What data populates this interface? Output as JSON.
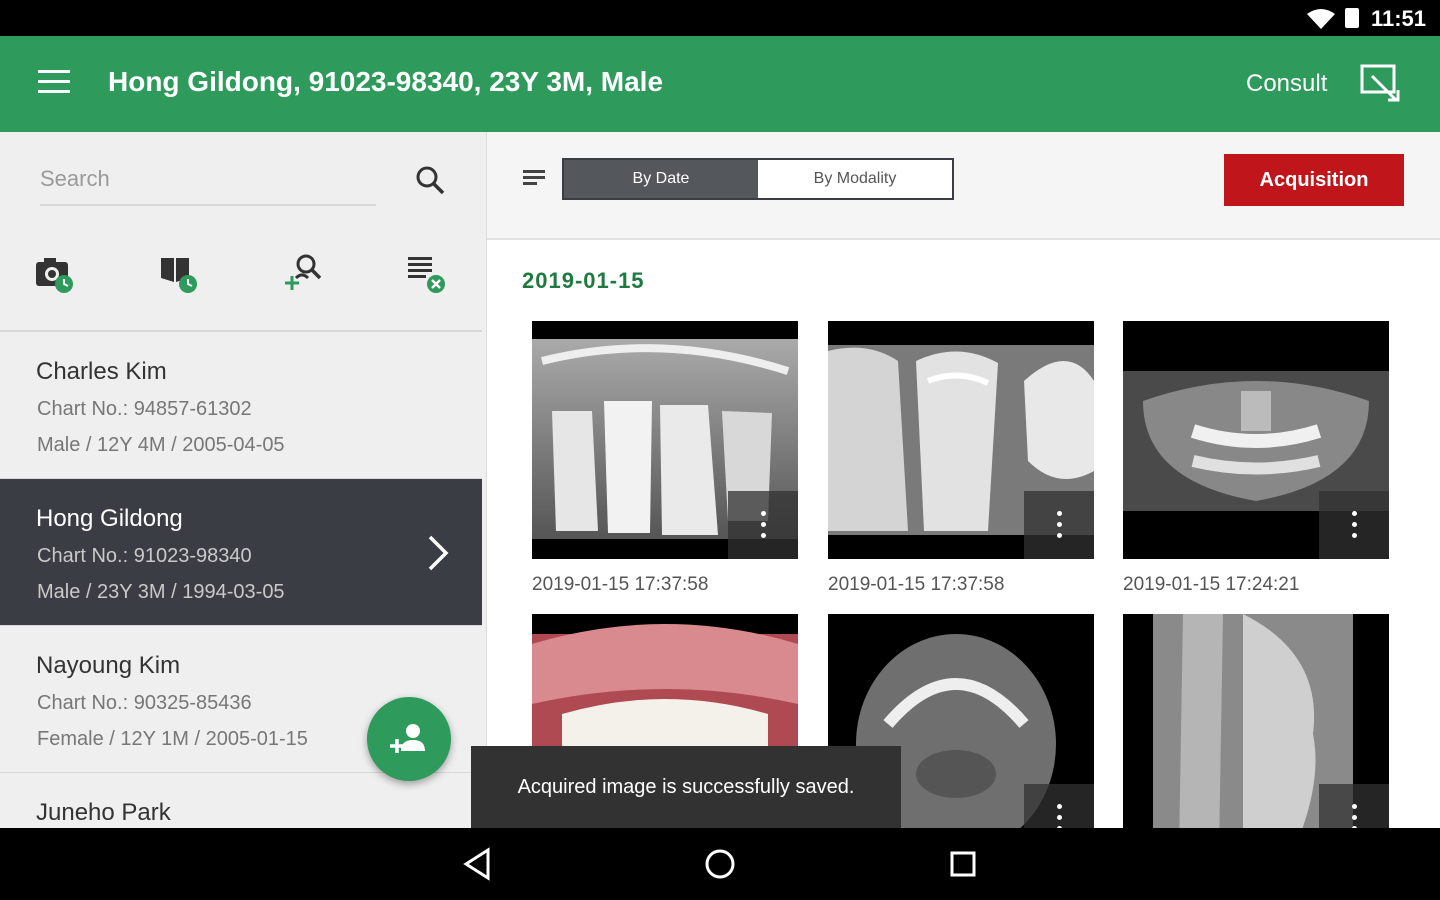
{
  "status": {
    "time": "11:51"
  },
  "header": {
    "title": "Hong Gildong, 91023-98340, 23Y 3M, Male",
    "consult_label": "Consult"
  },
  "search": {
    "placeholder": "Search"
  },
  "patients": [
    {
      "name": "Charles Kim",
      "chart": "Chart No.: 94857-61302",
      "info": "Male / 12Y 4M / 2005-04-05"
    },
    {
      "name": "Hong Gildong",
      "chart": "Chart No.: 91023-98340",
      "info": "Male / 23Y 3M / 1994-03-05"
    },
    {
      "name": "Nayoung Kim",
      "chart": "Chart No.: 90325-85436",
      "info": "Female / 12Y 1M / 2005-01-15"
    },
    {
      "name": "Juneho Park",
      "chart": "",
      "info": ""
    }
  ],
  "view_toggle": {
    "by_date": "By Date",
    "by_modality": "By Modality"
  },
  "acquisition_label": "Acquisition",
  "gallery": {
    "date": "2019-01-15",
    "images": [
      {
        "timestamp": "2019-01-15 17:37:58"
      },
      {
        "timestamp": "2019-01-15 17:37:58"
      },
      {
        "timestamp": "2019-01-15 17:24:21"
      }
    ]
  },
  "toast": "Acquired image is successfully saved.",
  "colors": {
    "primary": "#2e9a5b",
    "accent": "#c0161b",
    "dark": "#3a3d43",
    "date_green": "#1f7a3f"
  }
}
